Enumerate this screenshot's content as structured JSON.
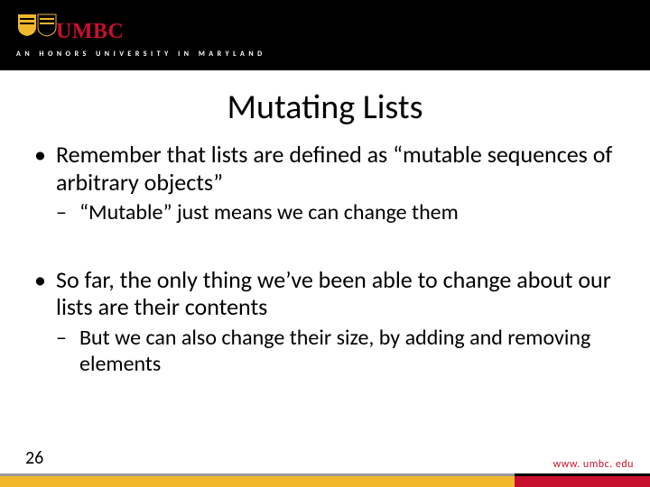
{
  "header": {
    "logo_text": "UMBC",
    "tagline": "AN HONORS UNIVERSITY IN MARYLAND"
  },
  "title": "Mutating Lists",
  "bullets": {
    "b1": "Remember that lists are defined as “mutable sequences of arbitrary objects”",
    "b1s1": "“Mutable” just means we can change them",
    "b2": "So far, the only thing we’ve been able to change about our lists are their contents",
    "b2s1": "But we can also change their size, by adding and removing elements"
  },
  "footer": {
    "page": "26",
    "url": "www. umbc. edu"
  }
}
